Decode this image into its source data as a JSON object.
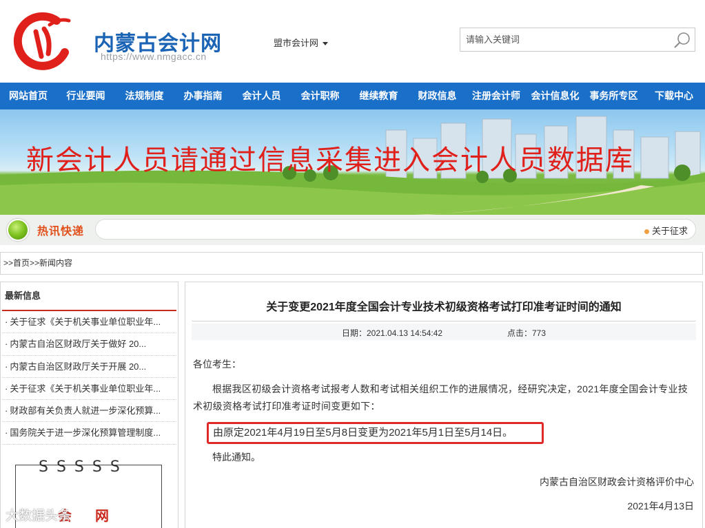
{
  "header": {
    "site_title": "内蒙古会计网",
    "site_url": "https://www.nmgacc.cn",
    "city_select": "盟市会计网",
    "search_placeholder": "请输入关键词"
  },
  "nav": {
    "items": [
      "网站首页",
      "行业要闻",
      "法规制度",
      "办事指南",
      "会计人员",
      "会计职称",
      "继续教育",
      "财政信息",
      "注册会计师",
      "会计信息化",
      "事务所专区",
      "下载中心"
    ]
  },
  "banner": {
    "text": "新会计人员请通过信息采集进入会计人员数据库"
  },
  "ticker": {
    "label": "热讯快递",
    "news": "关于征求"
  },
  "breadcrumb": {
    "prefix": ">>",
    "home": "首页",
    "separator": ">>",
    "current": "新闻内容"
  },
  "sidebar": {
    "title": "最新信息",
    "items": [
      "关于征求《关于机关事业单位职业年...",
      "内蒙古自治区财政厅关于做好 20...",
      "内蒙古自治区财政厅关于开展 20...",
      "关于征求《关于机关事业单位职业年...",
      "财政部有关负责人就进一步深化预算...",
      "国务院关于进一步深化预算管理制度..."
    ],
    "notebook_rings": "SSSSS",
    "notebook_text": "会网"
  },
  "watermark": "大数据头条",
  "article": {
    "title": "关于变更2021年度全国会计专业技术初级资格考试打印准考证时间的通知",
    "date": "日期：2021.04.13 14:54:42",
    "views": "点击：773",
    "greeting": "各位考生：",
    "body": "根据我区初级会计资格考试报考人数和考试相关组织工作的进展情况，经研究决定，2021年度全国会计专业技术初级资格考试打印准考证时间变更如下：",
    "change": "由原定2021年4月19日至5月8日变更为2021年5月1日至5月14日。",
    "notice": "特此通知。",
    "org": "内蒙古自治区财政会计资格评价中心",
    "sign_date": "2021年4月13日"
  },
  "colors": {
    "brand_blue": "#1a6fc9",
    "logo_red": "#e0201b",
    "highlight_red": "#e02a2a",
    "ticker_orange": "#e2501c"
  }
}
